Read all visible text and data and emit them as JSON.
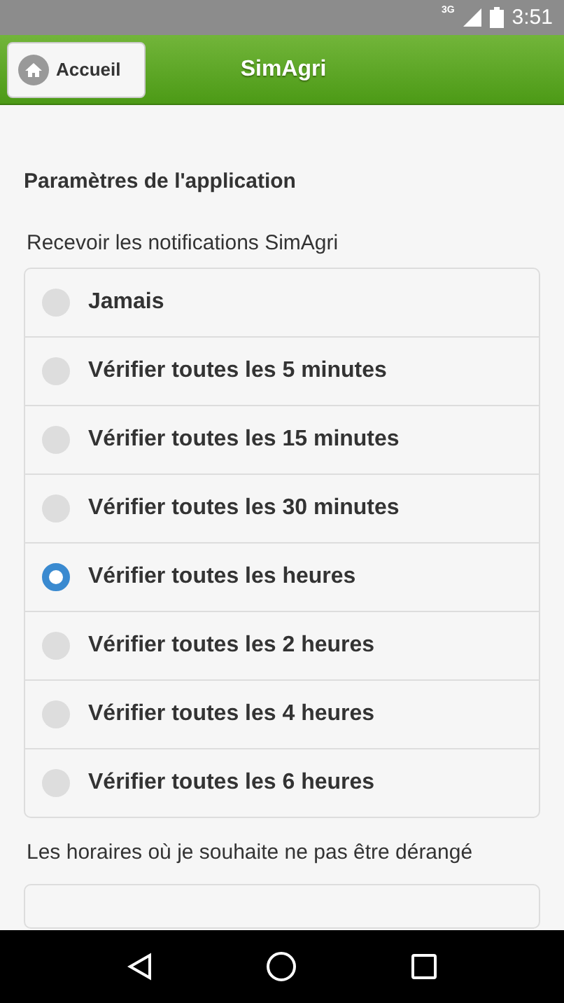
{
  "status_bar": {
    "network": "3G",
    "time": "3:51"
  },
  "header": {
    "home_button": "Accueil",
    "title": "SimAgri"
  },
  "section_title": "Paramètres de l'application",
  "notifications": {
    "label": "Recevoir les notifications SimAgri",
    "options": [
      {
        "label": "Jamais",
        "selected": false
      },
      {
        "label": "Vérifier toutes les 5 minutes",
        "selected": false
      },
      {
        "label": "Vérifier toutes les 15 minutes",
        "selected": false
      },
      {
        "label": "Vérifier toutes les 30 minutes",
        "selected": false
      },
      {
        "label": "Vérifier toutes les heures",
        "selected": true
      },
      {
        "label": "Vérifier toutes les 2 heures",
        "selected": false
      },
      {
        "label": "Vérifier toutes les 4 heures",
        "selected": false
      },
      {
        "label": "Vérifier toutes les 6 heures",
        "selected": false
      }
    ]
  },
  "quiet_hours": {
    "label": "Les horaires où je souhaite ne pas être dérangé"
  }
}
